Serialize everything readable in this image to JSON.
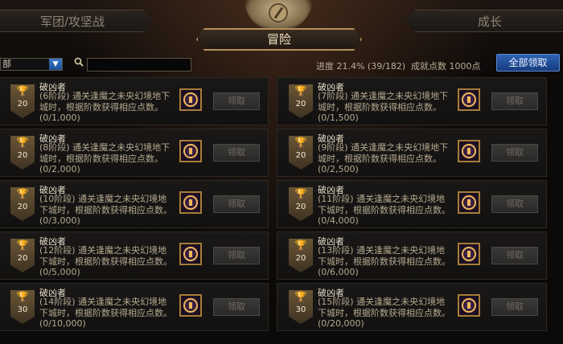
{
  "tabs": {
    "left": "军团/攻坚战",
    "right": "成长",
    "active": "冒险"
  },
  "filter": {
    "dropdown_value": "部",
    "search_value": ""
  },
  "stats": {
    "progress": "进度  21.4% (39/182)",
    "points": "成就点数 1000点"
  },
  "claim_all_label": "全部领取",
  "cards_left": [
    {
      "title": "破凶者",
      "desc": "(6阶段) 通关逢魔之未央幻境地下城时，根据阶数获得相应点数。",
      "progress": "(0/1,000)",
      "badge": "20",
      "button": "领取"
    },
    {
      "title": "破凶者",
      "desc": "(8阶段) 通关逢魔之未央幻境地下城时，根据阶数获得相应点数。",
      "progress": "(0/2,000)",
      "badge": "20",
      "button": "领取"
    },
    {
      "title": "破凶者",
      "desc": "(10阶段) 通关逢魔之未央幻境地下城时，根据阶数获得相应点数。",
      "progress": "(0/3,000)",
      "badge": "20",
      "button": "领取"
    },
    {
      "title": "破凶者",
      "desc": "(12阶段) 通关逢魔之未央幻境地下城时，根据阶数获得相应点数。",
      "progress": "(0/5,000)",
      "badge": "20",
      "button": "领取"
    },
    {
      "title": "破凶者",
      "desc": "(14阶段) 通关逢魔之未央幻境地下城时，根据阶数获得相应点数。",
      "progress": "(0/10,000)",
      "badge": "30",
      "button": "领取"
    }
  ],
  "cards_right": [
    {
      "title": "破凶者",
      "desc": "(7阶段) 通关逢魔之未央幻境地下城时，根据阶数获得相应点数。",
      "progress": "(0/1,500)",
      "badge": "20",
      "button": "领取"
    },
    {
      "title": "破凶者",
      "desc": "(9阶段) 通关逢魔之未央幻境地下城时，根据阶数获得相应点数。",
      "progress": "(0/2,500)",
      "badge": "20",
      "button": "领取"
    },
    {
      "title": "破凶者",
      "desc": "(11阶段) 通关逢魔之未央幻境地下城时，根据阶数获得相应点数。",
      "progress": "(0/4,000)",
      "badge": "20",
      "button": "领取"
    },
    {
      "title": "破凶者",
      "desc": "(13阶段) 通关逢魔之未央幻境地下城时，根据阶数获得相应点数。",
      "progress": "(0/6,000)",
      "badge": "20",
      "button": "领取"
    },
    {
      "title": "破凶者",
      "desc": "(15阶段) 通关逢魔之未央幻境地下城时，根据阶数获得相应点数。",
      "progress": "(0/20,000)",
      "badge": "30",
      "button": "领取"
    }
  ]
}
